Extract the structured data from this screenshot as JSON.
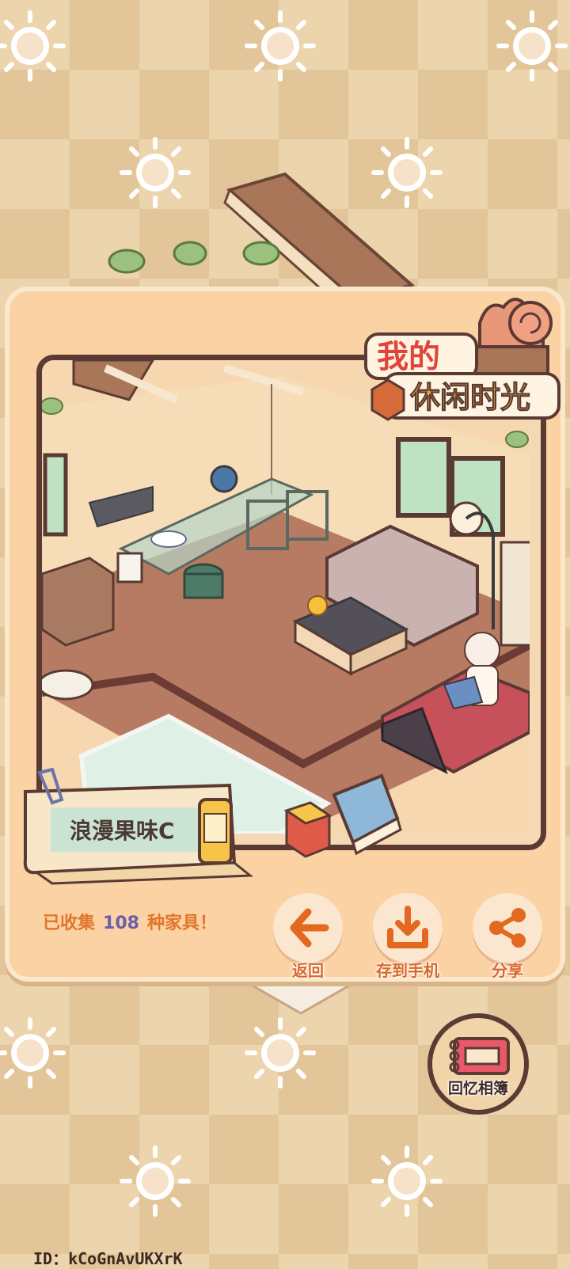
{
  "game": {
    "logo_line1": "我的",
    "logo_line2": "休闲时光"
  },
  "card": {
    "room_name": "浪漫果味C"
  },
  "stats": {
    "prefix": "已收集",
    "count": "108",
    "suffix": "种家具！"
  },
  "actions": {
    "back": "返回",
    "save": "存到手机",
    "share": "分享"
  },
  "album": {
    "label": "回忆相簿"
  },
  "user": {
    "id_text": "ID：kCoGnAvUKXrK"
  },
  "colors": {
    "accent_orange": "#e2752a",
    "count_purple": "#6a5fa8",
    "panel_bg": "#fbd2a4",
    "frame_dark": "#5a3a32"
  }
}
